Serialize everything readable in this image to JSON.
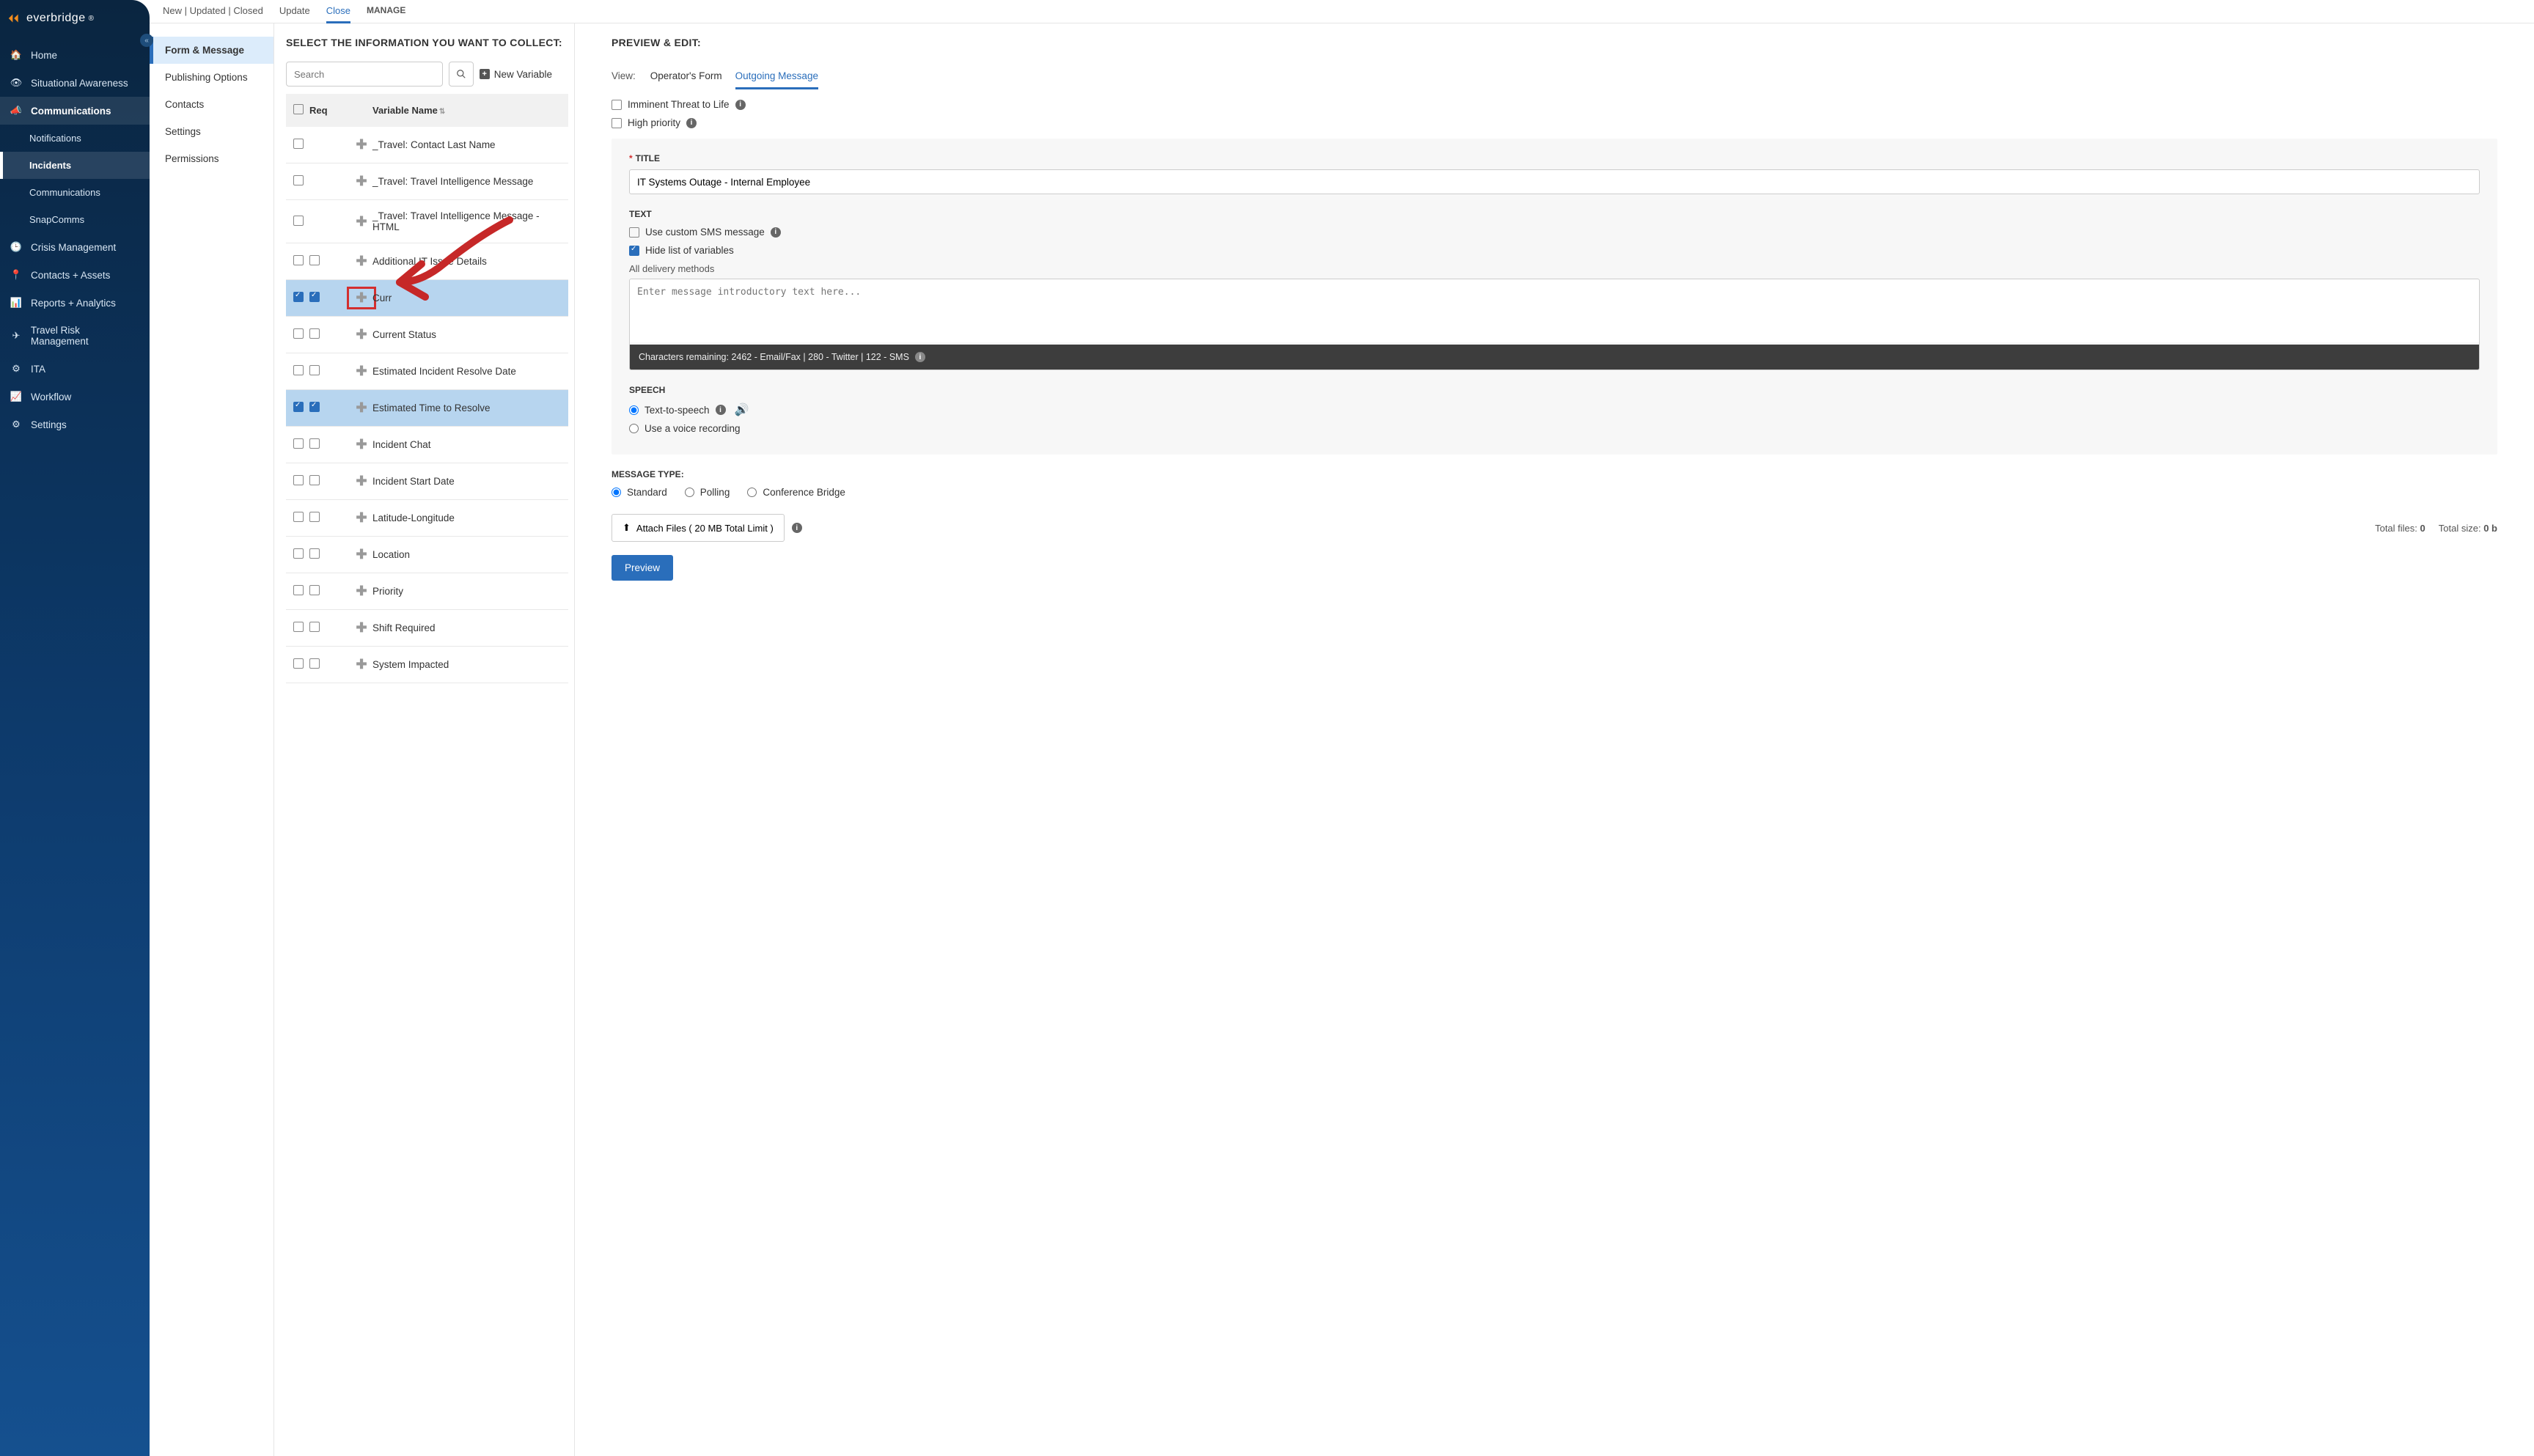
{
  "brand": "everbridge",
  "sidebar": {
    "items": [
      {
        "icon": "home",
        "label": "Home"
      },
      {
        "icon": "eye",
        "label": "Situational Awareness"
      },
      {
        "icon": "megaphone",
        "label": "Communications",
        "active": true
      },
      {
        "icon": "",
        "label": "Notifications",
        "sub": true
      },
      {
        "icon": "",
        "label": "Incidents",
        "sub": true,
        "subactive": true
      },
      {
        "icon": "",
        "label": "Communications",
        "sub": true
      },
      {
        "icon": "",
        "label": "SnapComms",
        "sub": true
      },
      {
        "icon": "clock",
        "label": "Crisis Management"
      },
      {
        "icon": "pin",
        "label": "Contacts + Assets"
      },
      {
        "icon": "chart",
        "label": "Reports + Analytics"
      },
      {
        "icon": "plane",
        "label": "Travel Risk Management"
      },
      {
        "icon": "ita",
        "label": "ITA"
      },
      {
        "icon": "workflow",
        "label": "Workflow"
      },
      {
        "icon": "gear",
        "label": "Settings"
      }
    ]
  },
  "topTabs": [
    "New | Updated | Closed",
    "Update",
    "Close",
    "MANAGE"
  ],
  "activeTopTab": "Close",
  "subnav": [
    "Form & Message",
    "Publishing Options",
    "Contacts",
    "Settings",
    "Permissions"
  ],
  "activeSubnav": "Form & Message",
  "middle": {
    "title": "SELECT THE INFORMATION YOU WANT TO COLLECT:",
    "searchPlaceholder": "Search",
    "newVariable": "New Variable",
    "headers": {
      "req": "Req",
      "name": "Variable Name"
    },
    "rows": [
      {
        "c1": false,
        "c2": null,
        "name": "_Travel: Contact Last Name"
      },
      {
        "c1": false,
        "c2": null,
        "name": "_Travel: Travel Intelligence Message"
      },
      {
        "c1": false,
        "c2": null,
        "name": "_Travel: Travel Intelligence Message - HTML"
      },
      {
        "c1": false,
        "c2": false,
        "name": "Additional IT Issue Details"
      },
      {
        "c1": true,
        "c2": true,
        "name": "Curr",
        "selected": true,
        "highlight": true
      },
      {
        "c1": false,
        "c2": false,
        "name": "Current Status"
      },
      {
        "c1": false,
        "c2": false,
        "name": "Estimated Incident Resolve Date"
      },
      {
        "c1": true,
        "c2": true,
        "name": "Estimated Time to Resolve",
        "selected": true
      },
      {
        "c1": false,
        "c2": false,
        "name": "Incident Chat"
      },
      {
        "c1": false,
        "c2": false,
        "name": "Incident Start Date"
      },
      {
        "c1": false,
        "c2": false,
        "name": "Latitude-Longitude"
      },
      {
        "c1": false,
        "c2": false,
        "name": "Location"
      },
      {
        "c1": false,
        "c2": false,
        "name": "Priority"
      },
      {
        "c1": false,
        "c2": false,
        "name": "Shift Required"
      },
      {
        "c1": false,
        "c2": false,
        "name": "System Impacted"
      }
    ]
  },
  "right": {
    "title": "PREVIEW & EDIT:",
    "viewLabel": "View:",
    "viewTabs": [
      "Operator's Form",
      "Outgoing Message"
    ],
    "activeViewTab": "Outgoing Message",
    "threatLabel": "Imminent Threat to Life",
    "priorityLabel": "High priority",
    "titleLabel": "TITLE",
    "titleValue": "IT Systems Outage - Internal Employee",
    "textLabel": "TEXT",
    "useCustomSms": "Use custom SMS message",
    "hideVars": "Hide list of variables",
    "deliveryLabel": "All delivery methods",
    "textareaPlaceholder": "Enter message introductory text here...",
    "charBar": "Characters remaining:   2462 - Email/Fax   |   280 - Twitter   |   122 - SMS",
    "speechLabel": "SPEECH",
    "tts": "Text-to-speech",
    "voiceRec": "Use a voice recording",
    "msgTypeLabel": "MESSAGE TYPE:",
    "msgTypes": [
      "Standard",
      "Polling",
      "Conference Bridge"
    ],
    "attachLabel": "Attach Files ( 20 MB Total Limit )",
    "totalFiles": "Total files:",
    "totalFilesVal": "0",
    "totalSize": "Total size:",
    "totalSizeVal": "0 b",
    "previewBtn": "Preview"
  }
}
